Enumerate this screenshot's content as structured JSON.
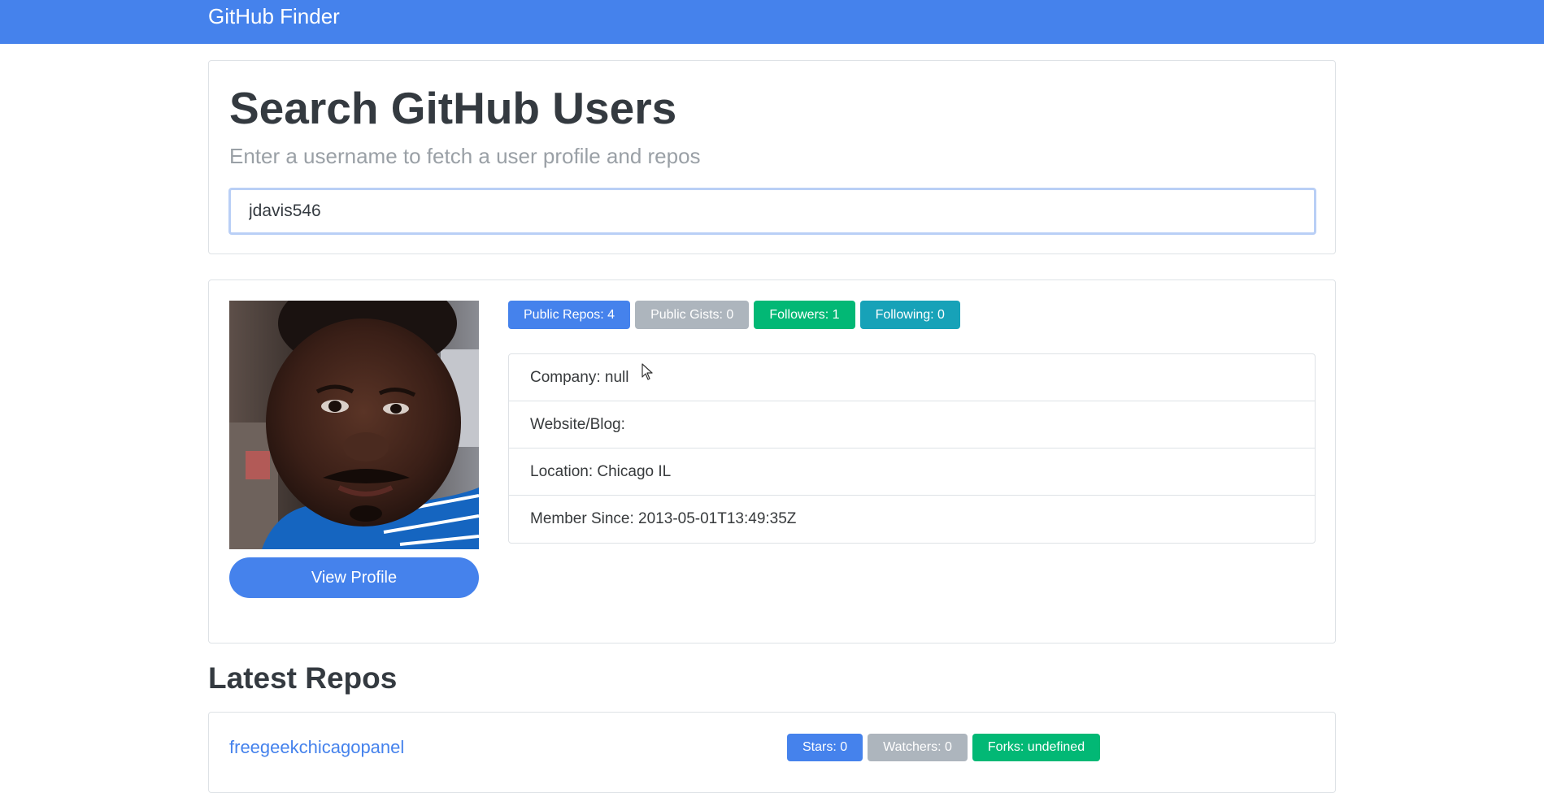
{
  "navbar": {
    "brand": "GitHub Finder"
  },
  "search": {
    "title": "Search GitHub Users",
    "subtitle": "Enter a username to fetch a user profile and repos",
    "input_value": "jdavis546"
  },
  "profile": {
    "view_profile_label": "View Profile",
    "badges": {
      "public_repos": "Public Repos: 4",
      "public_gists": "Public Gists: 0",
      "followers": "Followers: 1",
      "following": "Following: 0"
    },
    "details": {
      "company": "Company: null",
      "website": "Website/Blog:",
      "location": "Location: Chicago IL",
      "member_since": "Member Since: 2013-05-01T13:49:35Z"
    }
  },
  "repos": {
    "heading": "Latest Repos",
    "items": [
      {
        "name": "freegeekchicagopanel",
        "stars": "Stars: 0",
        "watchers": "Watchers: 0",
        "forks": "Forks: undefined"
      }
    ]
  },
  "colors": {
    "primary": "#4582ec",
    "secondary": "#adb5bd",
    "success": "#02b875",
    "info": "#17a2b8"
  }
}
